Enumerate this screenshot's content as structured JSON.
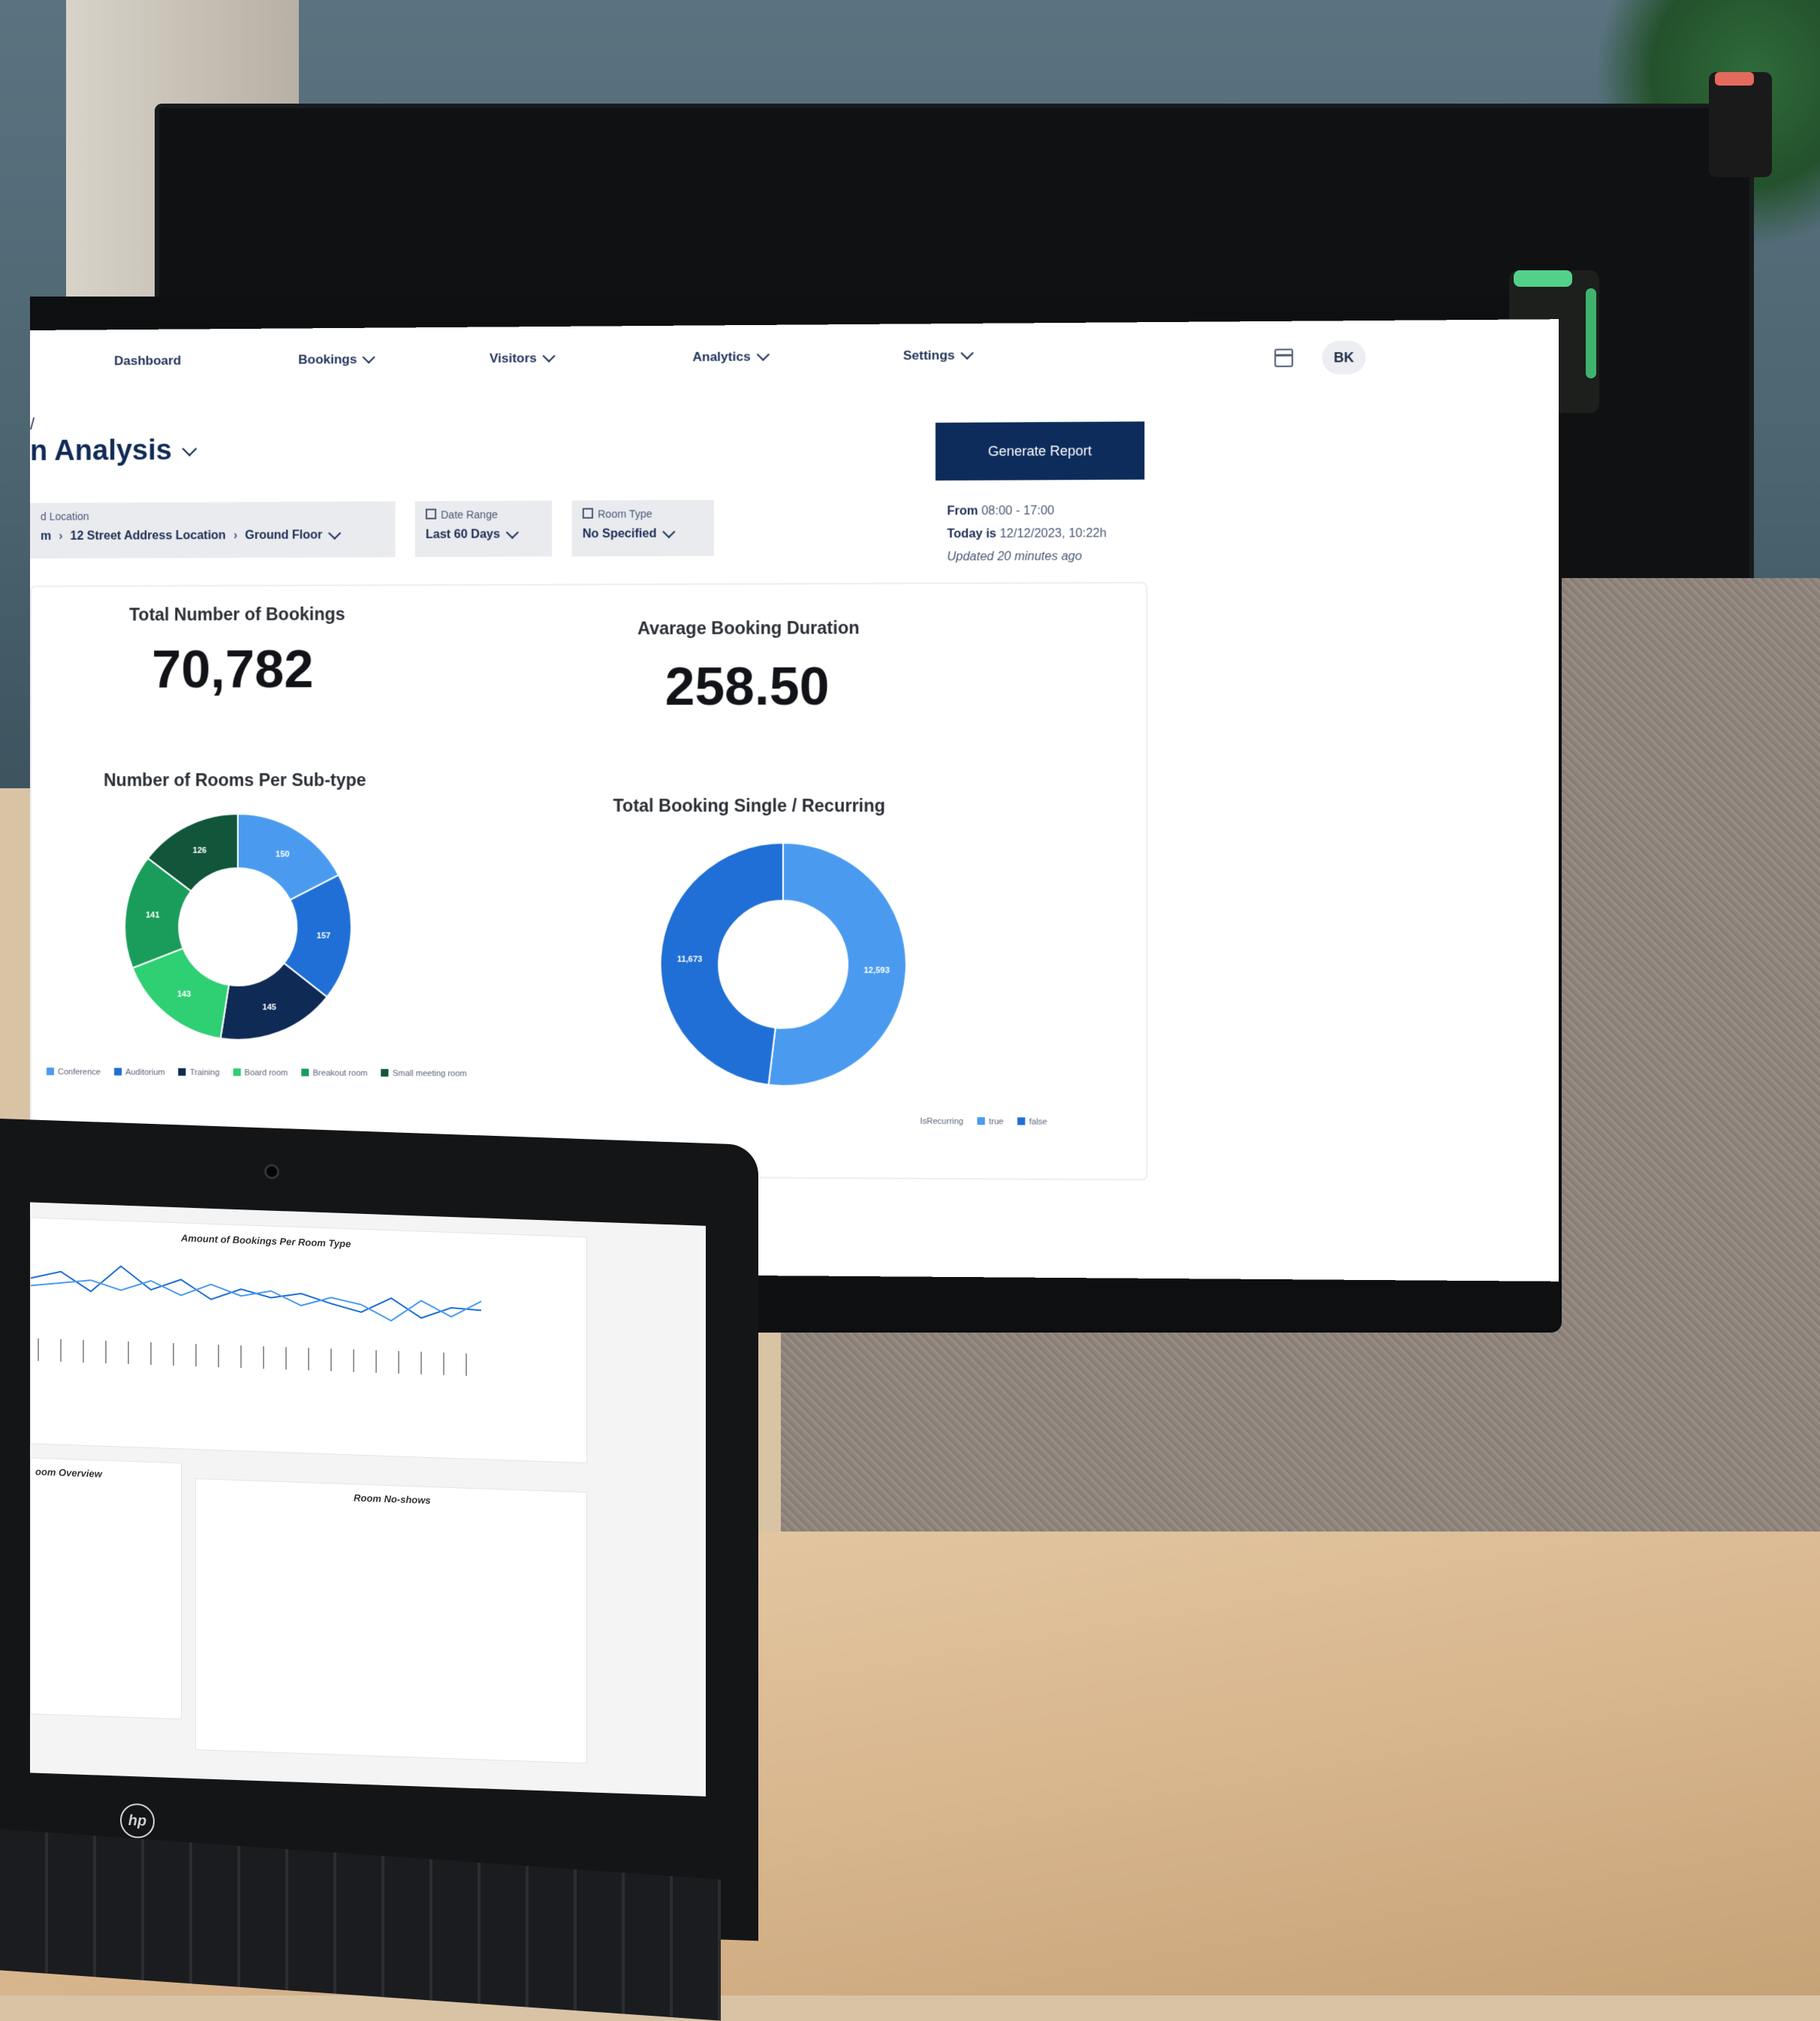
{
  "nav": {
    "items": [
      "Dashboard",
      "Bookings",
      "Visitors",
      "Analytics",
      "Settings"
    ],
    "avatar_initials": "BK"
  },
  "header": {
    "breadcrumb": "/",
    "title": "n Analysis",
    "generate_report_label": "Generate Report"
  },
  "filters": {
    "location": {
      "label": "d Location",
      "path": [
        "m",
        "12 Street Address Location",
        "Ground Floor"
      ]
    },
    "date_range": {
      "label": "Date Range",
      "value": "Last 60 Days"
    },
    "room_type": {
      "label": "Room Type",
      "value": "No Specified"
    }
  },
  "meta": {
    "from_label": "From",
    "from_value": "08:00 - 17:00",
    "today_label": "Today is",
    "today_value": "12/12/2023, 10:22h",
    "updated": "Updated 20 minutes ago"
  },
  "stats": {
    "total_bookings_label": "Total Number of Bookings",
    "total_bookings_value": "70,782",
    "avg_duration_label": "Avarage Booking Duration",
    "avg_duration_value": "258.50"
  },
  "charts": {
    "rooms_title": "Number of Rooms Per Sub-type",
    "rooms_legend": [
      "Conference",
      "Auditorium",
      "Training",
      "Board room",
      "Breakout room",
      "Small meeting room"
    ],
    "booking_title": "Total Booking Single / Recurring",
    "booking_legend_prefix": "IsRecurring",
    "booking_legend": [
      "true",
      "false"
    ]
  },
  "colors": {
    "navy": "#0d2c5c",
    "blue_light": "#4a9bf0",
    "blue_mid": "#1f6fd6",
    "navy_dark": "#0e2a55",
    "green_light": "#2fcf73",
    "green_mid": "#1a9d5a",
    "green_dark": "#11553b"
  },
  "laptop": {
    "line_title": "Amount of Bookings Per Room Type",
    "overview_title": "oom Overview",
    "noshows_title": "Room No-shows",
    "logo": "hp"
  },
  "chart_data": [
    {
      "type": "pie",
      "title": "Number of Rooms Per Sub-type",
      "labels": [
        "Conference",
        "Auditorium",
        "Training",
        "Board room",
        "Breakout room",
        "Small meeting room"
      ],
      "values": [
        150,
        157,
        145,
        143,
        141,
        126
      ]
    },
    {
      "type": "pie",
      "title": "Total Booking Single / Recurring",
      "labels": [
        "true",
        "false"
      ],
      "values": [
        12593,
        11673
      ]
    }
  ]
}
